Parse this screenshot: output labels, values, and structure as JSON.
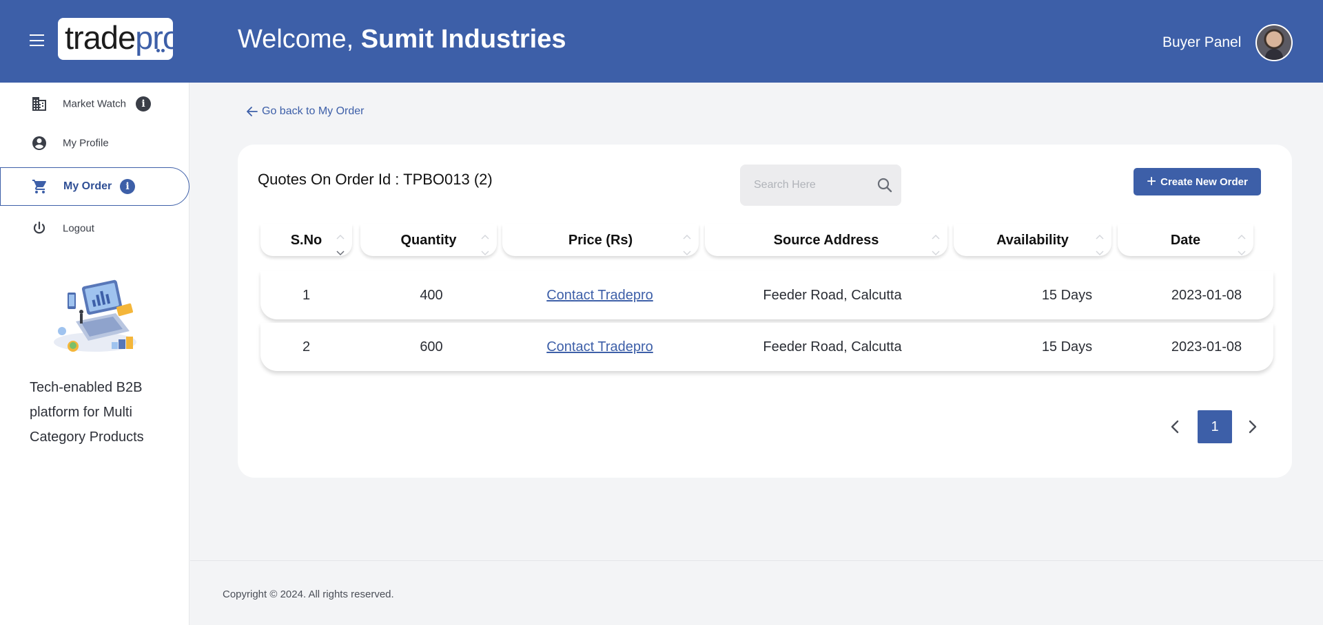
{
  "header": {
    "logo_part1": "trade",
    "logo_part2": "pro",
    "welcome_prefix": "Welcome, ",
    "company_name": "Sumit Industries",
    "panel_label": "Buyer Panel"
  },
  "sidebar": {
    "items": [
      {
        "label": "Market Watch",
        "icon": "building-icon",
        "info": true
      },
      {
        "label": "My Profile",
        "icon": "account-circle-icon",
        "info": false
      },
      {
        "label": "My Order",
        "icon": "cart-icon",
        "info": true,
        "active": true
      },
      {
        "label": "Logout",
        "icon": "power-icon",
        "info": false
      }
    ],
    "tagline": "Tech-enabled B2B platform for Multi Category Products"
  },
  "main": {
    "back_link": "Go back to My Order",
    "title": "Quotes On Order Id : TPBO013 (2)",
    "search_placeholder": "Search Here",
    "create_button": "Create New Order"
  },
  "table": {
    "columns": [
      "S.No",
      "Quantity",
      "Price (Rs)",
      "Source Address",
      "Availability",
      "Date"
    ],
    "rows": [
      {
        "sno": "1",
        "quantity": "400",
        "price": "Contact Tradepro",
        "address": "Feeder Road, Calcutta",
        "availability": "15 Days",
        "date": "2023-01-08"
      },
      {
        "sno": "2",
        "quantity": "600",
        "price": "Contact Tradepro",
        "address": "Feeder Road, Calcutta",
        "availability": "15 Days",
        "date": "2023-01-08"
      }
    ]
  },
  "pagination": {
    "current_page": "1"
  },
  "footer": {
    "copyright": "Copyright © 2024. All rights reserved."
  },
  "colors": {
    "brand": "#3d5fa8",
    "background": "#f3f4f6"
  }
}
